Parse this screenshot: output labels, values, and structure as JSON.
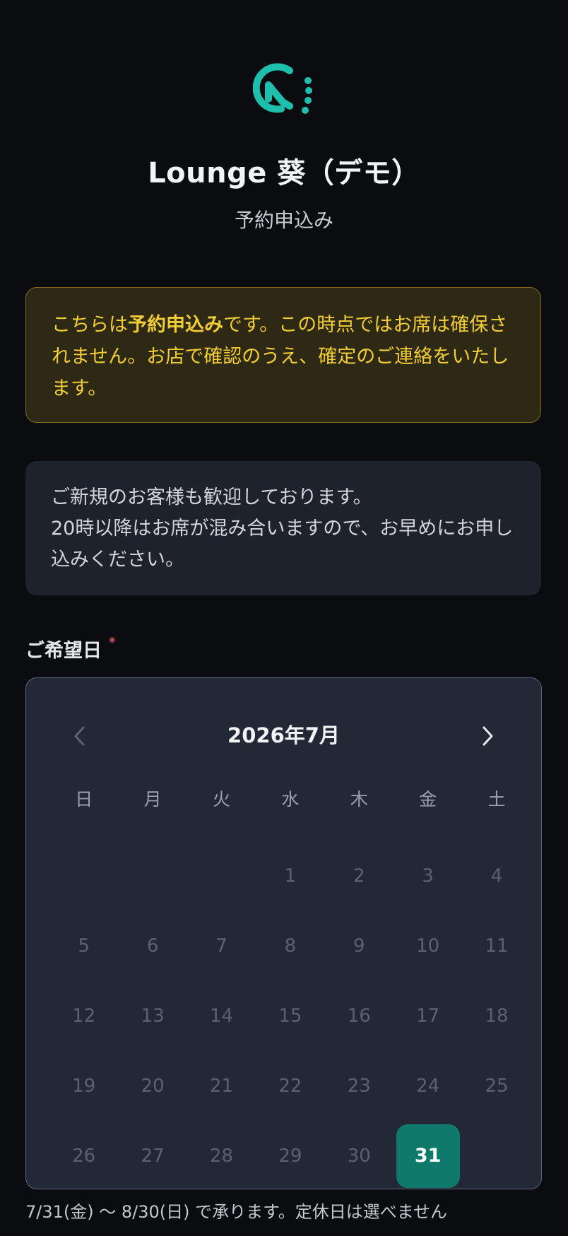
{
  "header": {
    "title": "Lounge 葵（デモ）",
    "subtitle": "予約申込み",
    "logo_icon": "lounge-logo-icon",
    "accent_color": "#1fbfae"
  },
  "notice": {
    "pre": "こちらは",
    "bold": "予約申込み",
    "post": "です。この時点ではお席は確保されません。お店で確認のうえ、確定のご連絡をいたします。",
    "text_color": "#f3cd36"
  },
  "info": {
    "line1": "ご新規のお客様も歓迎しております。",
    "line2": "20時以降はお席が混み合いますので、お早めにお申し込みください。"
  },
  "date_field": {
    "label": "ご希望日",
    "required_mark": "*"
  },
  "calendar": {
    "month_title": "2026年7月",
    "prev_icon": "chevron-left-icon",
    "next_icon": "chevron-right-icon",
    "weekdays": [
      "日",
      "月",
      "火",
      "水",
      "木",
      "金",
      "土"
    ],
    "leading_blanks": 3,
    "days": [
      "1",
      "2",
      "3",
      "4",
      "5",
      "6",
      "7",
      "8",
      "9",
      "10",
      "11",
      "12",
      "13",
      "14",
      "15",
      "16",
      "17",
      "18",
      "19",
      "20",
      "21",
      "22",
      "23",
      "24",
      "25",
      "26",
      "27",
      "28",
      "29",
      "30",
      "31"
    ],
    "selected_day": "31",
    "selected_color": "#0f7a6c"
  },
  "hint": {
    "text": "7/31(金) 〜 8/30(日) で承ります。定休日は選べません"
  }
}
